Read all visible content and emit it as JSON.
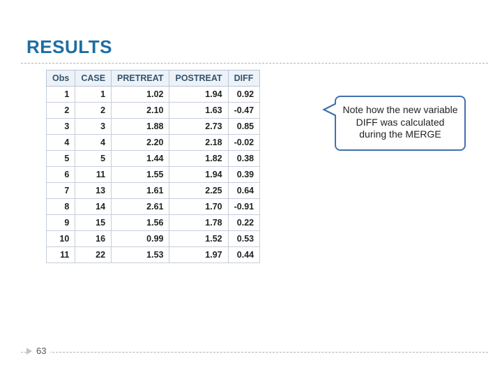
{
  "title": "RESULTS",
  "page_number": "63",
  "callout_text": "Note how the new variable DIFF was calculated during the MERGE",
  "table": {
    "headers": [
      "Obs",
      "CASE",
      "PRETREAT",
      "POSTREAT",
      "DIFF"
    ],
    "rows": [
      [
        "1",
        "1",
        "1.02",
        "1.94",
        "0.92"
      ],
      [
        "2",
        "2",
        "2.10",
        "1.63",
        "-0.47"
      ],
      [
        "3",
        "3",
        "1.88",
        "2.73",
        "0.85"
      ],
      [
        "4",
        "4",
        "2.20",
        "2.18",
        "-0.02"
      ],
      [
        "5",
        "5",
        "1.44",
        "1.82",
        "0.38"
      ],
      [
        "6",
        "11",
        "1.55",
        "1.94",
        "0.39"
      ],
      [
        "7",
        "13",
        "1.61",
        "2.25",
        "0.64"
      ],
      [
        "8",
        "14",
        "2.61",
        "1.70",
        "-0.91"
      ],
      [
        "9",
        "15",
        "1.56",
        "1.78",
        "0.22"
      ],
      [
        "10",
        "16",
        "0.99",
        "1.52",
        "0.53"
      ],
      [
        "11",
        "22",
        "1.53",
        "1.97",
        "0.44"
      ]
    ]
  }
}
